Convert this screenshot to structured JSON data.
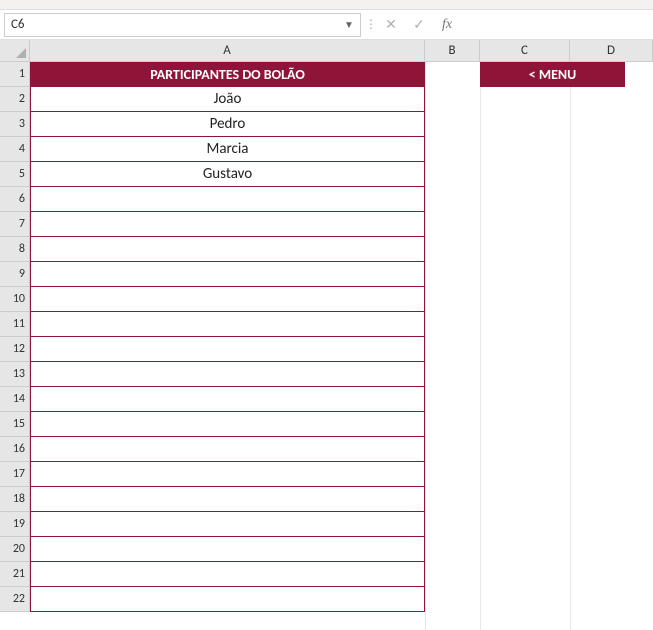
{
  "namebox": {
    "value": "C6"
  },
  "formula_bar": {
    "value": ""
  },
  "columns": [
    "A",
    "B",
    "C",
    "D"
  ],
  "row_count": 22,
  "sheet": {
    "header": "PARTICIPANTES DO BOLÃO",
    "participants": [
      "João",
      "Pedro",
      "Marcia",
      "Gustavo"
    ],
    "empty_rows": 17
  },
  "menu_button": {
    "label": "< MENU"
  },
  "colors": {
    "accent": "#8e1537"
  }
}
